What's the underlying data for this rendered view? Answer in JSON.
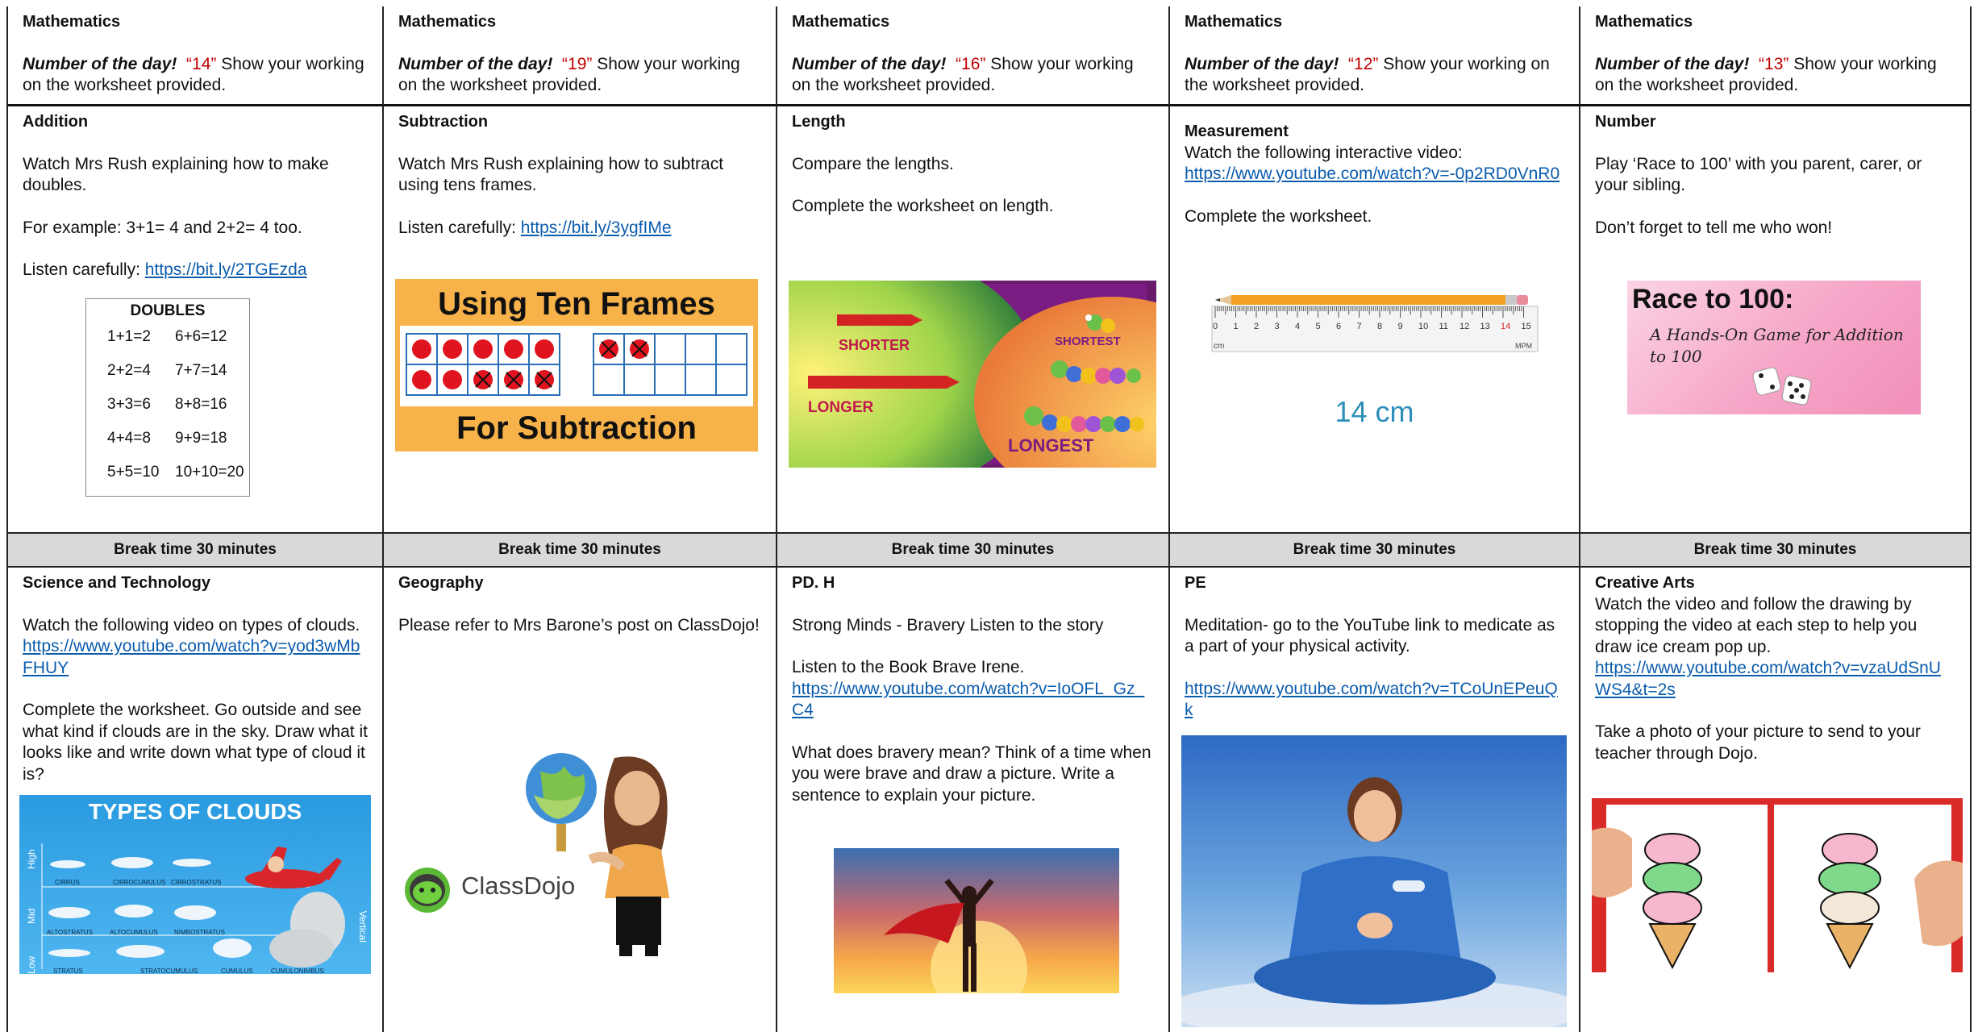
{
  "math": {
    "title": "Mathematics",
    "number_label": "Number of the day!",
    "suffix": "Show your working on the worksheet provided.",
    "days": [
      {
        "number": "“14”"
      },
      {
        "number": "“19”"
      },
      {
        "number": "“16”"
      },
      {
        "number": "“12”"
      },
      {
        "number": "“13”"
      }
    ]
  },
  "middle": {
    "addition": {
      "title": "Addition",
      "p1": "Watch Mrs Rush explaining how to make doubles.",
      "p2": "For example: 3+1= 4 and 2+2= 4 too.",
      "listen": "Listen carefully:",
      "link": "https://bit.ly/2TGEzda",
      "poster_title": "DOUBLES",
      "poster_eqs": [
        "1+1=2",
        "6+6=12",
        "2+2=4",
        "7+7=14",
        "3+3=6",
        "8+8=16",
        "4+4=8",
        "9+9=18",
        "5+5=10",
        "10+10=20"
      ]
    },
    "subtraction": {
      "title": "Subtraction",
      "p1": "Watch Mrs Rush explaining how to subtract using tens frames.",
      "listen": "Listen carefully:",
      "link": "https://bit.ly/3ygfIMe",
      "banner_top": "Using Ten Frames",
      "banner_bottom": "For Subtraction"
    },
    "length": {
      "title": "Length",
      "p1": "Compare the lengths.",
      "p2": "Complete the worksheet on length.",
      "img_labels": {
        "shorter": "SHORTER",
        "longer": "LONGER",
        "shortest": "SHORTEST",
        "longest": "LONGEST"
      }
    },
    "measurement": {
      "title": "Measurement",
      "p1": "Watch the following interactive video:",
      "link": "https://www.youtube.com/watch?v=-0p2RD0VnR0",
      "p2": "Complete the worksheet.",
      "ruler_numbers": [
        "0",
        "1",
        "2",
        "3",
        "4",
        "5",
        "6",
        "7",
        "8",
        "9",
        "10",
        "11",
        "12",
        "13",
        "14",
        "15"
      ],
      "ruler_unit": "cm",
      "ruler_brand": "MPM",
      "result": "14 cm"
    },
    "number": {
      "title": "Number",
      "p1": "Play ‘Race to 100’ with you parent, carer, or your sibling.",
      "p2": "Don’t forget to tell me who won!",
      "banner_title": "Race to 100:",
      "banner_sub": "A Hands-On Game for Addition to 100"
    }
  },
  "break": {
    "label": "Break time 30 minutes"
  },
  "bottom": {
    "science": {
      "title": "Science and Technology",
      "p1": "Watch the following video on types of clouds.",
      "link": "https://www.youtube.com/watch?v=yod3wMbFHUY",
      "p2": "Complete the worksheet. Go outside and see what kind if clouds are in the sky. Draw what it looks like and write down what type of cloud it is?",
      "poster": {
        "title": "TYPES OF CLOUDS",
        "rows": [
          "High",
          "Mid",
          "Low"
        ],
        "side": "Vertical",
        "high": [
          "CIRRUS",
          "CIRROCUMULUS",
          "CIRROSTRATUS"
        ],
        "mid": [
          "ALTOSTRATUS",
          "ALTOCUMULUS",
          "NIMBOSTRATUS"
        ],
        "low": [
          "STRATUS",
          "STRATOCUMULUS",
          "CUMULUS",
          "CUMULONIMBUS"
        ]
      }
    },
    "geography": {
      "title": "Geography",
      "p1": "Please refer to Mrs Barone’s post on ClassDojo!",
      "logo": "ClassDojo"
    },
    "pdh": {
      "title": "PD. H",
      "p1": "Strong Minds - Bravery Listen to the story",
      "p2": "Listen to the Book Brave Irene.",
      "link": "https://www.youtube.com/watch?v=IoOFL_Gz_C4",
      "p3": "What does bravery mean? Think of a time when you were brave and draw a picture. Write a sentence to explain your picture."
    },
    "pe": {
      "title": "PE",
      "p1": "Meditation- go to the YouTube link to medicate as a part of your physical activity.",
      "link": "https://www.youtube.com/watch?v=TCoUnEPeuQk"
    },
    "arts": {
      "title": "Creative Arts",
      "p1": "Watch the video and follow the drawing by stopping the video at each step to help you draw ice cream pop up.",
      "link": "https://www.youtube.com/watch?v=vzaUdSnUWS4&t=2s",
      "p2": "Take a photo of your picture to send to your teacher through Dojo."
    }
  },
  "colors": {
    "link": "#0b5cad",
    "number": "#c00000",
    "break_bg": "#d9d9d9",
    "border": "#222222"
  }
}
